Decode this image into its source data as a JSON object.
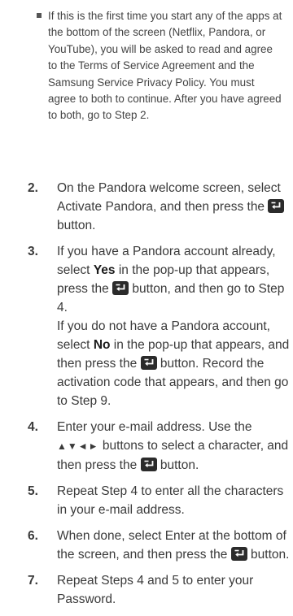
{
  "note": {
    "text": "If this is the first time you start any of the apps at the bottom of the screen (Netflix, Pandora, or YouTube), you will be asked to read and agree to the Terms of Service Agreement and the Samsung Service Privacy Policy. You must agree to both to continue. After you have agreed to both, go to Step 2."
  },
  "steps": [
    {
      "num": "2.",
      "p1": "On the Pandora welcome screen, select Activate Pandora, and then press the",
      "p2": "button."
    },
    {
      "num": "3.",
      "a1": "If you have a Pandora account already, select",
      "a_bold": "Yes",
      "a2": "in the pop-up that appears, press the",
      "a3": "button, and then go to Step 4.",
      "b1": "If you do not have a Pandora account, select",
      "b_bold": "No",
      "b2": "in the pop-up that appears, and then press the",
      "b3": "button. Record the activation code that appears, and then go to Step 9."
    },
    {
      "num": "4.",
      "p1": "Enter your e-mail address. Use the",
      "arrows": "▲▼◄►",
      "p2": "buttons to select a character, and then press the",
      "p3": "button."
    },
    {
      "num": "5.",
      "text": "Repeat Step 4 to enter all the characters in your e-mail address."
    },
    {
      "num": "6.",
      "p1": "When done, select Enter at the bottom of the screen, and then press the",
      "p2": "button."
    },
    {
      "num": "7.",
      "text": "Repeat Steps 4 and 5 to enter your Password."
    }
  ],
  "icon_name": "enter-button-icon",
  "colors": {
    "text": "#3a3a3a",
    "icon_bg": "#2b2b2b",
    "icon_fg": "#ffffff"
  }
}
